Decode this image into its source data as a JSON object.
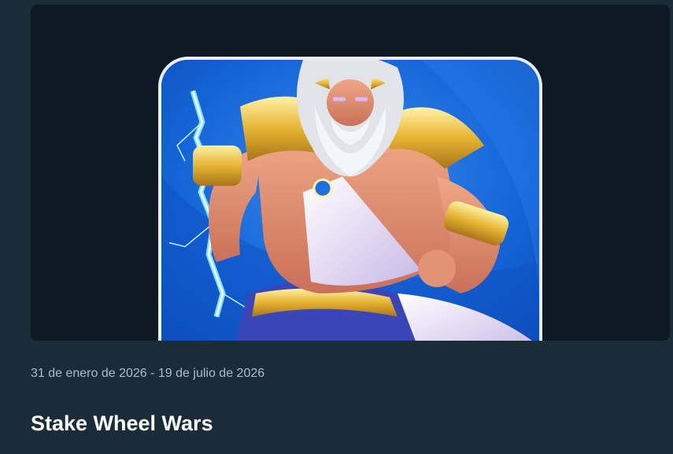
{
  "promotion": {
    "date_range": "31 de enero de 2026 - 19 de julio de 2026",
    "title": "Stake Wheel Wars",
    "image_subject": "zeus-character-art"
  },
  "colors": {
    "page_background": "#1a2c38",
    "banner_background": "#0f1923",
    "tile_blue": "#1565d8",
    "gold": "#e6b432",
    "lightning": "#7fe3ff",
    "date_text": "#b1bad3",
    "title_text": "#ffffff"
  }
}
